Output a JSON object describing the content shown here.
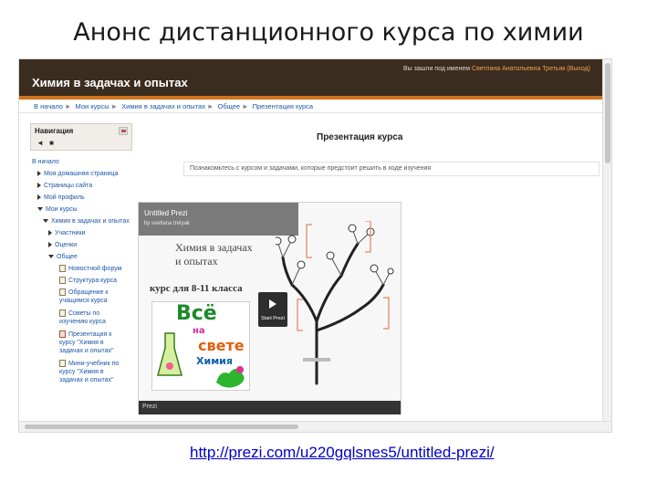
{
  "slide": {
    "title": "Анонс дистанционного курса по химии",
    "link": "http://prezi.com/u220gqlsnes5/untitled-prezi/"
  },
  "header": {
    "site_title": "Химия в задачах и опытах",
    "login_prefix": "Вы зашли под именем",
    "login_user": "Светлана Анатольевна Третьяк",
    "logout": "(Выход)"
  },
  "breadcrumb": [
    "В начало",
    "Мои курсы",
    "Химия в задачах и опытах",
    "Общее",
    "Презентация курса"
  ],
  "nav": {
    "title": "Навигация",
    "items": [
      {
        "label": "В начало",
        "level": 0,
        "kind": "none"
      },
      {
        "label": "Моя домашняя страница",
        "level": 1,
        "kind": "right"
      },
      {
        "label": "Страницы сайта",
        "level": 1,
        "kind": "right"
      },
      {
        "label": "Мой профиль",
        "level": 1,
        "kind": "right"
      },
      {
        "label": "Мои курсы",
        "level": 1,
        "kind": "down"
      },
      {
        "label": "Химия в задачах и опытах",
        "level": 2,
        "kind": "down"
      },
      {
        "label": "Участники",
        "level": 3,
        "kind": "right"
      },
      {
        "label": "Оценки",
        "level": 3,
        "kind": "right"
      },
      {
        "label": "Общее",
        "level": 3,
        "kind": "down"
      },
      {
        "label": "Новостной форум",
        "level": 4,
        "kind": "doc"
      },
      {
        "label": "Структура курса",
        "level": 4,
        "kind": "doc"
      },
      {
        "label": "Обращение к учащимся курса",
        "level": 4,
        "kind": "doc"
      },
      {
        "label": "Советы по изучению курса",
        "level": 4,
        "kind": "doc"
      },
      {
        "label": "Презентация к курсу \"Химия в задачах и опытах\"",
        "level": 4,
        "kind": "quiz"
      },
      {
        "label": "Мини-учебник по курсу \"Химия в задачах и опытах\"",
        "level": 4,
        "kind": "doc"
      }
    ]
  },
  "main": {
    "heading": "Презентация курса",
    "description": "Познакомьтесь с курсом и задачами, которые предстоит решить в ходе изучения"
  },
  "prezi": {
    "name": "Untitled Prezi",
    "by": "by svetlana tretyak",
    "big_text": "Химия в задачах",
    "big_text2": "и опытах",
    "mid_text": "курс для 8-11 класса",
    "start_label": "Start Prezi",
    "footer": "Prezi",
    "book_lines": [
      "Всё",
      "на",
      "свете",
      "Химия"
    ]
  },
  "colors": {
    "header_bg": "#3b2c20",
    "header_accent": "#d0731f",
    "link": "#1c56a8",
    "caption_link": "#0000cc"
  }
}
